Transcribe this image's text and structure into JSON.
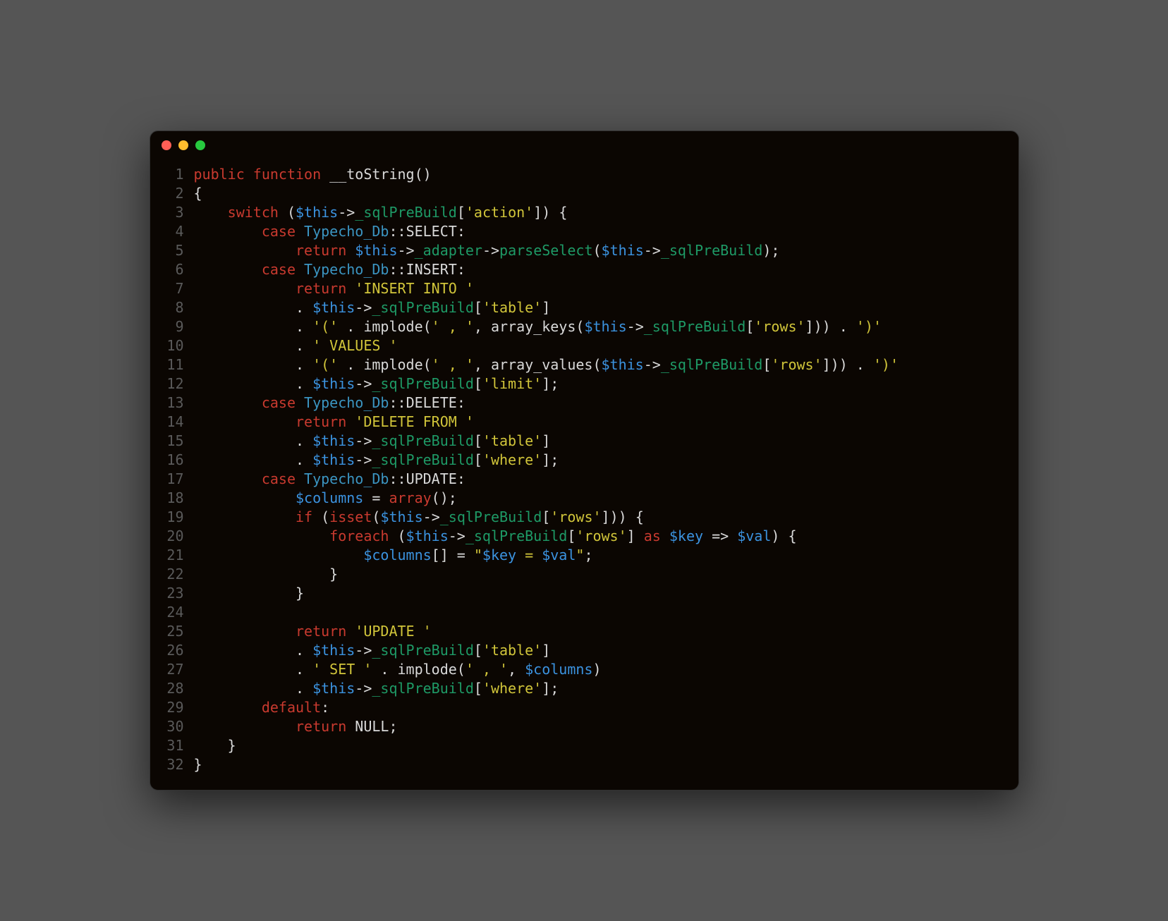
{
  "window": {
    "traffic_lights": {
      "red": "#ff5f56",
      "yellow": "#ffbd2e",
      "green": "#27c93f"
    }
  },
  "editor": {
    "line_numbers": [
      "1",
      "2",
      "3",
      "4",
      "5",
      "6",
      "7",
      "8",
      "9",
      "10",
      "11",
      "12",
      "13",
      "14",
      "15",
      "16",
      "17",
      "18",
      "19",
      "20",
      "21",
      "22",
      "23",
      "24",
      "25",
      "26",
      "27",
      "28",
      "29",
      "30",
      "31",
      "32"
    ],
    "segments": [
      [
        [
          "public ",
          1
        ],
        [
          "function ",
          1
        ],
        [
          "__toString",
          0
        ],
        [
          "()",
          0
        ]
      ],
      [
        [
          "{",
          0
        ]
      ],
      [
        [
          "    ",
          0
        ],
        [
          "switch ",
          1
        ],
        [
          "(",
          0
        ],
        [
          "$this",
          2
        ],
        [
          "->",
          0
        ],
        [
          "_sqlPreBuild",
          3
        ],
        [
          "[",
          0
        ],
        [
          "'action'",
          4
        ],
        [
          "]) {",
          0
        ]
      ],
      [
        [
          "        ",
          0
        ],
        [
          "case ",
          1
        ],
        [
          "Typecho_Db",
          5
        ],
        [
          "::",
          0
        ],
        [
          "SELECT",
          0
        ],
        [
          ":",
          0
        ]
      ],
      [
        [
          "            ",
          0
        ],
        [
          "return ",
          1
        ],
        [
          "$this",
          2
        ],
        [
          "->",
          0
        ],
        [
          "_adapter",
          3
        ],
        [
          "->",
          0
        ],
        [
          "parseSelect",
          3
        ],
        [
          "(",
          0
        ],
        [
          "$this",
          2
        ],
        [
          "->",
          0
        ],
        [
          "_sqlPreBuild",
          3
        ],
        [
          ");",
          0
        ]
      ],
      [
        [
          "        ",
          0
        ],
        [
          "case ",
          1
        ],
        [
          "Typecho_Db",
          5
        ],
        [
          "::",
          0
        ],
        [
          "INSERT",
          0
        ],
        [
          ":",
          0
        ]
      ],
      [
        [
          "            ",
          0
        ],
        [
          "return ",
          1
        ],
        [
          "'INSERT INTO '",
          4
        ]
      ],
      [
        [
          "            . ",
          0
        ],
        [
          "$this",
          2
        ],
        [
          "->",
          0
        ],
        [
          "_sqlPreBuild",
          3
        ],
        [
          "[",
          0
        ],
        [
          "'table'",
          4
        ],
        [
          "]",
          0
        ]
      ],
      [
        [
          "            . ",
          0
        ],
        [
          "'(' ",
          4
        ],
        [
          ". implode(",
          0
        ],
        [
          "' , '",
          4
        ],
        [
          ", array_keys(",
          0
        ],
        [
          "$this",
          2
        ],
        [
          "->",
          0
        ],
        [
          "_sqlPreBuild",
          3
        ],
        [
          "[",
          0
        ],
        [
          "'rows'",
          4
        ],
        [
          "])) . ",
          0
        ],
        [
          "')'",
          4
        ]
      ],
      [
        [
          "            . ",
          0
        ],
        [
          "' VALUES '",
          4
        ]
      ],
      [
        [
          "            . ",
          0
        ],
        [
          "'(' ",
          4
        ],
        [
          ". implode(",
          0
        ],
        [
          "' , '",
          4
        ],
        [
          ", array_values(",
          0
        ],
        [
          "$this",
          2
        ],
        [
          "->",
          0
        ],
        [
          "_sqlPreBuild",
          3
        ],
        [
          "[",
          0
        ],
        [
          "'rows'",
          4
        ],
        [
          "])) . ",
          0
        ],
        [
          "')'",
          4
        ]
      ],
      [
        [
          "            . ",
          0
        ],
        [
          "$this",
          2
        ],
        [
          "->",
          0
        ],
        [
          "_sqlPreBuild",
          3
        ],
        [
          "[",
          0
        ],
        [
          "'limit'",
          4
        ],
        [
          "];",
          0
        ]
      ],
      [
        [
          "        ",
          0
        ],
        [
          "case ",
          1
        ],
        [
          "Typecho_Db",
          5
        ],
        [
          "::",
          0
        ],
        [
          "DELETE",
          0
        ],
        [
          ":",
          0
        ]
      ],
      [
        [
          "            ",
          0
        ],
        [
          "return ",
          1
        ],
        [
          "'DELETE FROM '",
          4
        ]
      ],
      [
        [
          "            . ",
          0
        ],
        [
          "$this",
          2
        ],
        [
          "->",
          0
        ],
        [
          "_sqlPreBuild",
          3
        ],
        [
          "[",
          0
        ],
        [
          "'table'",
          4
        ],
        [
          "]",
          0
        ]
      ],
      [
        [
          "            . ",
          0
        ],
        [
          "$this",
          2
        ],
        [
          "->",
          0
        ],
        [
          "_sqlPreBuild",
          3
        ],
        [
          "[",
          0
        ],
        [
          "'where'",
          4
        ],
        [
          "];",
          0
        ]
      ],
      [
        [
          "        ",
          0
        ],
        [
          "case ",
          1
        ],
        [
          "Typecho_Db",
          5
        ],
        [
          "::",
          0
        ],
        [
          "UPDATE",
          0
        ],
        [
          ":",
          0
        ]
      ],
      [
        [
          "            ",
          0
        ],
        [
          "$columns",
          2
        ],
        [
          " = ",
          0
        ],
        [
          "array",
          1
        ],
        [
          "();",
          0
        ]
      ],
      [
        [
          "            ",
          0
        ],
        [
          "if ",
          1
        ],
        [
          "(",
          0
        ],
        [
          "isset",
          1
        ],
        [
          "(",
          0
        ],
        [
          "$this",
          2
        ],
        [
          "->",
          0
        ],
        [
          "_sqlPreBuild",
          3
        ],
        [
          "[",
          0
        ],
        [
          "'rows'",
          4
        ],
        [
          "])) {",
          0
        ]
      ],
      [
        [
          "                ",
          0
        ],
        [
          "foreach ",
          1
        ],
        [
          "(",
          0
        ],
        [
          "$this",
          2
        ],
        [
          "->",
          0
        ],
        [
          "_sqlPreBuild",
          3
        ],
        [
          "[",
          0
        ],
        [
          "'rows'",
          4
        ],
        [
          "] ",
          0
        ],
        [
          "as ",
          1
        ],
        [
          "$key",
          2
        ],
        [
          " => ",
          0
        ],
        [
          "$val",
          2
        ],
        [
          ") {",
          0
        ]
      ],
      [
        [
          "                    ",
          0
        ],
        [
          "$columns",
          2
        ],
        [
          "[] = ",
          0
        ],
        [
          "\"",
          4
        ],
        [
          "$key",
          2
        ],
        [
          " = ",
          4
        ],
        [
          "$val",
          2
        ],
        [
          "\"",
          4
        ],
        [
          ";",
          0
        ]
      ],
      [
        [
          "                }",
          0
        ]
      ],
      [
        [
          "            }",
          0
        ]
      ],
      [
        [
          "",
          0
        ]
      ],
      [
        [
          "            ",
          0
        ],
        [
          "return ",
          1
        ],
        [
          "'UPDATE '",
          4
        ]
      ],
      [
        [
          "            . ",
          0
        ],
        [
          "$this",
          2
        ],
        [
          "->",
          0
        ],
        [
          "_sqlPreBuild",
          3
        ],
        [
          "[",
          0
        ],
        [
          "'table'",
          4
        ],
        [
          "]",
          0
        ]
      ],
      [
        [
          "            . ",
          0
        ],
        [
          "' SET ' ",
          4
        ],
        [
          ". implode(",
          0
        ],
        [
          "' , '",
          4
        ],
        [
          ", ",
          0
        ],
        [
          "$columns",
          2
        ],
        [
          ")",
          0
        ]
      ],
      [
        [
          "            . ",
          0
        ],
        [
          "$this",
          2
        ],
        [
          "->",
          0
        ],
        [
          "_sqlPreBuild",
          3
        ],
        [
          "[",
          0
        ],
        [
          "'where'",
          4
        ],
        [
          "];",
          0
        ]
      ],
      [
        [
          "        ",
          0
        ],
        [
          "default",
          1
        ],
        [
          ":",
          0
        ]
      ],
      [
        [
          "            ",
          0
        ],
        [
          "return ",
          1
        ],
        [
          "NULL",
          0
        ],
        [
          ";",
          0
        ]
      ],
      [
        [
          "    }",
          0
        ]
      ],
      [
        [
          "}",
          0
        ]
      ]
    ]
  }
}
